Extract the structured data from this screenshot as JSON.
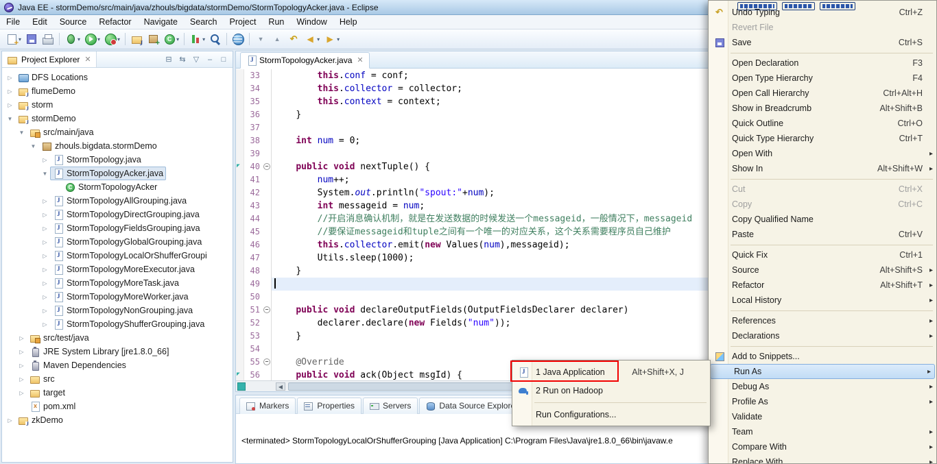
{
  "titlebar": {
    "title": "Java EE - stormDemo/src/main/java/zhouls/bigdata/stormDemo/StormTopologyAcker.java - Eclipse"
  },
  "menubar": {
    "items": [
      "File",
      "Edit",
      "Source",
      "Refactor",
      "Navigate",
      "Search",
      "Project",
      "Run",
      "Window",
      "Help"
    ]
  },
  "toolbar": {
    "buttons": [
      {
        "name": "new-wizard",
        "dropdown": true
      },
      {
        "name": "save"
      },
      {
        "name": "print"
      },
      {
        "sep": true
      },
      {
        "name": "debug",
        "dropdown": true
      },
      {
        "name": "run",
        "dropdown": true
      },
      {
        "name": "run-external",
        "dropdown": true
      },
      {
        "sep": true
      },
      {
        "name": "new-java-project"
      },
      {
        "name": "new-package"
      },
      {
        "name": "new-class",
        "dropdown": true
      },
      {
        "sep": true
      },
      {
        "name": "coverage",
        "dropdown": true
      },
      {
        "name": "search"
      },
      {
        "sep": true
      },
      {
        "name": "web-browser"
      },
      {
        "sep": true
      },
      {
        "name": "next-annotation"
      },
      {
        "name": "prev-annotation"
      },
      {
        "name": "last-edit-location"
      },
      {
        "name": "back",
        "dropdown": true
      },
      {
        "name": "forward",
        "dropdown": true
      }
    ]
  },
  "project_explorer": {
    "title": "Project Explorer",
    "header_icons": [
      "collapse-all",
      "link-with-editor",
      "view-menu",
      "minimize",
      "maximize"
    ],
    "items": [
      {
        "label": "DFS Locations",
        "depth": 0,
        "state": "c",
        "icon": "dfs"
      },
      {
        "label": "flumeDemo",
        "depth": 0,
        "state": "c",
        "icon": "project"
      },
      {
        "label": "storm",
        "depth": 0,
        "state": "c",
        "icon": "project"
      },
      {
        "label": "stormDemo",
        "depth": 0,
        "state": "e",
        "icon": "project"
      },
      {
        "label": "src/main/java",
        "depth": 1,
        "state": "e",
        "icon": "srcfolder"
      },
      {
        "label": "zhouls.bigdata.stormDemo",
        "depth": 2,
        "state": "e",
        "icon": "package"
      },
      {
        "label": "StormTopology.java",
        "depth": 3,
        "state": "c",
        "icon": "jfile"
      },
      {
        "label": "StormTopologyAcker.java",
        "depth": 3,
        "state": "e",
        "icon": "jfile",
        "selected": true
      },
      {
        "label": "StormTopologyAcker",
        "depth": 4,
        "state": "n",
        "icon": "class"
      },
      {
        "label": "StormTopologyAllGrouping.java",
        "depth": 3,
        "state": "c",
        "icon": "jfile"
      },
      {
        "label": "StormTopologyDirectGrouping.java",
        "depth": 3,
        "state": "c",
        "icon": "jfile"
      },
      {
        "label": "StormTopologyFieldsGrouping.java",
        "depth": 3,
        "state": "c",
        "icon": "jfile"
      },
      {
        "label": "StormTopologyGlobalGrouping.java",
        "depth": 3,
        "state": "c",
        "icon": "jfile"
      },
      {
        "label": "StormTopologyLocalOrShufferGroupi",
        "depth": 3,
        "state": "c",
        "icon": "jfile"
      },
      {
        "label": "StormTopologyMoreExecutor.java",
        "depth": 3,
        "state": "c",
        "icon": "jfile"
      },
      {
        "label": "StormTopologyMoreTask.java",
        "depth": 3,
        "state": "c",
        "icon": "jfile"
      },
      {
        "label": "StormTopologyMoreWorker.java",
        "depth": 3,
        "state": "c",
        "icon": "jfile"
      },
      {
        "label": "StormTopologyNonGrouping.java",
        "depth": 3,
        "state": "c",
        "icon": "jfile"
      },
      {
        "label": "StormTopologyShufferGrouping.java",
        "depth": 3,
        "state": "c",
        "icon": "jfile"
      },
      {
        "label": "src/test/java",
        "depth": 1,
        "state": "c",
        "icon": "srcfolder"
      },
      {
        "label": "JRE System Library [jre1.8.0_66]",
        "depth": 1,
        "state": "c",
        "icon": "library"
      },
      {
        "label": "Maven Dependencies",
        "depth": 1,
        "state": "c",
        "icon": "library"
      },
      {
        "label": "src",
        "depth": 1,
        "state": "c",
        "icon": "folder"
      },
      {
        "label": "target",
        "depth": 1,
        "state": "c",
        "icon": "folder"
      },
      {
        "label": "pom.xml",
        "depth": 1,
        "state": "n",
        "icon": "xmlfile"
      },
      {
        "label": "zkDemo",
        "depth": 0,
        "state": "c",
        "icon": "project"
      }
    ]
  },
  "editor": {
    "tab_title": "StormTopologyAcker.java",
    "lines": [
      {
        "n": 33,
        "i": 2,
        "t": [
          [
            "kw",
            "this"
          ],
          [
            "pl",
            "."
          ],
          [
            "fl",
            "conf"
          ],
          [
            "pl",
            " = conf;"
          ]
        ]
      },
      {
        "n": 34,
        "i": 2,
        "t": [
          [
            "kw",
            "this"
          ],
          [
            "pl",
            "."
          ],
          [
            "fl",
            "collector"
          ],
          [
            "pl",
            " = collector;"
          ]
        ]
      },
      {
        "n": 35,
        "i": 2,
        "t": [
          [
            "kw",
            "this"
          ],
          [
            "pl",
            "."
          ],
          [
            "fl",
            "context"
          ],
          [
            "pl",
            " = context;"
          ]
        ]
      },
      {
        "n": 36,
        "i": 1,
        "t": [
          [
            "pl",
            "}"
          ]
        ]
      },
      {
        "n": 37,
        "i": 0,
        "t": []
      },
      {
        "n": 38,
        "i": 1,
        "t": [
          [
            "kw",
            "int"
          ],
          [
            "pl",
            " "
          ],
          [
            "fl",
            "num"
          ],
          [
            "pl",
            " = 0;"
          ]
        ]
      },
      {
        "n": 39,
        "i": 0,
        "t": []
      },
      {
        "n": 40,
        "i": 1,
        "fold": true,
        "mark": true,
        "t": [
          [
            "kw",
            "public"
          ],
          [
            "pl",
            " "
          ],
          [
            "kw",
            "void"
          ],
          [
            "pl",
            " nextTuple() {"
          ]
        ]
      },
      {
        "n": 41,
        "i": 2,
        "t": [
          [
            "fl",
            "num"
          ],
          [
            "pl",
            "++;"
          ]
        ]
      },
      {
        "n": 42,
        "i": 2,
        "t": [
          [
            "pl",
            "System."
          ],
          [
            "st",
            "out"
          ],
          [
            "pl",
            ".println("
          ],
          [
            "str",
            "\"spout:\""
          ],
          [
            "pl",
            "+"
          ],
          [
            "fl",
            "num"
          ],
          [
            "pl",
            ");"
          ]
        ]
      },
      {
        "n": 43,
        "i": 2,
        "t": [
          [
            "kw",
            "int"
          ],
          [
            "pl",
            " messageid = "
          ],
          [
            "fl",
            "num"
          ],
          [
            "pl",
            ";"
          ]
        ]
      },
      {
        "n": 44,
        "i": 2,
        "t": [
          [
            "com",
            "//开启消息确认机制，就是在发送数据的时候发送一个messageid，一般情况下，messageid"
          ]
        ]
      },
      {
        "n": 45,
        "i": 2,
        "t": [
          [
            "com",
            "//要保证messageid和tuple之间有一个唯一的对应关系，这个关系需要程序员自己维护"
          ]
        ]
      },
      {
        "n": 46,
        "i": 2,
        "t": [
          [
            "kw",
            "this"
          ],
          [
            "pl",
            "."
          ],
          [
            "fl",
            "collector"
          ],
          [
            "pl",
            ".emit("
          ],
          [
            "kw",
            "new"
          ],
          [
            "pl",
            " Values("
          ],
          [
            "fl",
            "num"
          ],
          [
            "pl",
            "),messageid);"
          ]
        ]
      },
      {
        "n": 47,
        "i": 2,
        "t": [
          [
            "pl",
            "Utils.sleep(1000);"
          ]
        ]
      },
      {
        "n": 48,
        "i": 1,
        "t": [
          [
            "pl",
            "}"
          ]
        ]
      },
      {
        "n": 49,
        "i": 0,
        "cur": true,
        "t": []
      },
      {
        "n": 50,
        "i": 0,
        "t": []
      },
      {
        "n": 51,
        "i": 1,
        "fold": true,
        "t": [
          [
            "kw",
            "public"
          ],
          [
            "pl",
            " "
          ],
          [
            "kw",
            "void"
          ],
          [
            "pl",
            " declareOutputFields(OutputFieldsDeclarer declarer)"
          ]
        ]
      },
      {
        "n": 52,
        "i": 2,
        "t": [
          [
            "pl",
            "declarer.declare("
          ],
          [
            "kw",
            "new"
          ],
          [
            "pl",
            " Fields("
          ],
          [
            "str",
            "\"num\""
          ],
          [
            "pl",
            "));"
          ]
        ]
      },
      {
        "n": 53,
        "i": 1,
        "t": [
          [
            "pl",
            "}"
          ]
        ]
      },
      {
        "n": 54,
        "i": 0,
        "t": []
      },
      {
        "n": 55,
        "i": 1,
        "fold": true,
        "t": [
          [
            "an",
            "@Override"
          ]
        ]
      },
      {
        "n": 56,
        "i": 1,
        "mark": true,
        "t": [
          [
            "kw",
            "public"
          ],
          [
            "pl",
            " "
          ],
          [
            "kw",
            "void"
          ],
          [
            "pl",
            " ack(Object msgId) {"
          ]
        ]
      }
    ]
  },
  "bottom_panel": {
    "tabs": [
      {
        "label": "Markers",
        "icon": "markers"
      },
      {
        "label": "Properties",
        "icon": "properties"
      },
      {
        "label": "Servers",
        "icon": "servers"
      },
      {
        "label": "Data Source Explorer",
        "icon": "dse"
      }
    ],
    "console_text": "<terminated> StormTopologyLocalOrShufferGrouping [Java Application] C:\\Program Files\\Java\\jre1.8.0_66\\bin\\javaw.e"
  },
  "context_menu": {
    "items": [
      {
        "label": "Undo Typing",
        "shortcut": "Ctrl+Z",
        "icon": "undo"
      },
      {
        "label": "Revert File",
        "disabled": true
      },
      {
        "label": "Save",
        "shortcut": "Ctrl+S",
        "icon": "msave"
      },
      {
        "sep": true
      },
      {
        "label": "Open Declaration",
        "shortcut": "F3"
      },
      {
        "label": "Open Type Hierarchy",
        "shortcut": "F4"
      },
      {
        "label": "Open Call Hierarchy",
        "shortcut": "Ctrl+Alt+H"
      },
      {
        "label": "Show in Breadcrumb",
        "shortcut": "Alt+Shift+B"
      },
      {
        "label": "Quick Outline",
        "shortcut": "Ctrl+O"
      },
      {
        "label": "Quick Type Hierarchy",
        "shortcut": "Ctrl+T"
      },
      {
        "label": "Open With",
        "submenu": true
      },
      {
        "label": "Show In",
        "shortcut": "Alt+Shift+W",
        "submenu": true
      },
      {
        "sep": true
      },
      {
        "label": "Cut",
        "shortcut": "Ctrl+X",
        "disabled": true
      },
      {
        "label": "Copy",
        "shortcut": "Ctrl+C",
        "disabled": true
      },
      {
        "label": "Copy Qualified Name"
      },
      {
        "label": "Paste",
        "shortcut": "Ctrl+V"
      },
      {
        "sep": true
      },
      {
        "label": "Quick Fix",
        "shortcut": "Ctrl+1"
      },
      {
        "label": "Source",
        "shortcut": "Alt+Shift+S",
        "submenu": true
      },
      {
        "label": "Refactor",
        "shortcut": "Alt+Shift+T",
        "submenu": true
      },
      {
        "label": "Local History",
        "submenu": true
      },
      {
        "sep": true
      },
      {
        "label": "References",
        "submenu": true
      },
      {
        "label": "Declarations",
        "submenu": true
      },
      {
        "sep": true
      },
      {
        "label": "Add to Snippets...",
        "icon": "snippet"
      },
      {
        "label": "Run As",
        "submenu": true,
        "highlighted": true
      },
      {
        "label": "Debug As",
        "submenu": true
      },
      {
        "label": "Profile As",
        "submenu": true
      },
      {
        "label": "Validate"
      },
      {
        "label": "Team",
        "submenu": true
      },
      {
        "label": "Compare With",
        "submenu": true
      },
      {
        "label": "Replace With",
        "submenu": true
      }
    ]
  },
  "run_as_submenu": {
    "items": [
      {
        "label": "1 Java Application",
        "shortcut": "Alt+Shift+X, J",
        "icon": "javaapp"
      },
      {
        "label": "2 Run on Hadoop",
        "icon": "hadoop"
      },
      {
        "sep": true
      },
      {
        "label": "Run Configurations..."
      }
    ]
  },
  "colors": {
    "keyword": "#7f0055",
    "string": "#2a00ff",
    "comment": "#3f7f5f",
    "field": "#0000c0",
    "selection_blue": "#c1dcf5",
    "annotation_red_box": "#f20000",
    "current_line": "#e4eefb"
  }
}
